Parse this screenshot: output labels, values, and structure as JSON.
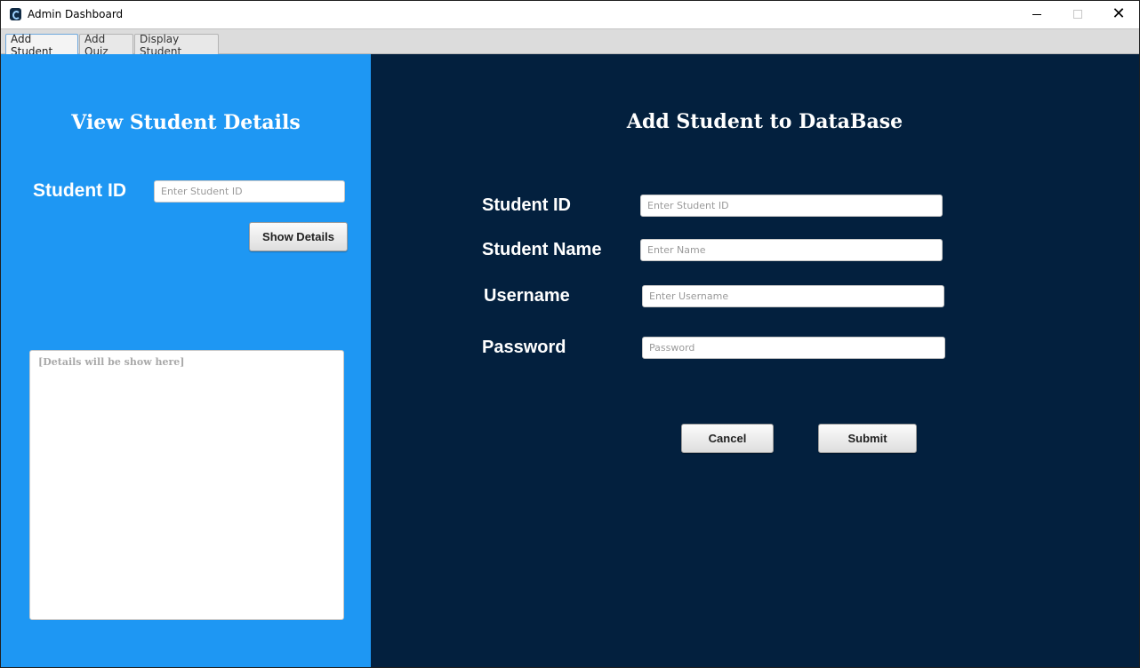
{
  "window": {
    "title": "Admin Dashboard",
    "minimize": "—",
    "maximize": "□",
    "close": "✕"
  },
  "tabs": [
    {
      "label": "Add Student",
      "active": true
    },
    {
      "label": "Add Quiz",
      "active": false
    },
    {
      "label": "Display Student",
      "active": false
    }
  ],
  "view_panel": {
    "title": "View Student Details",
    "student_id_label": "Student ID",
    "student_id_placeholder": "Enter Student ID",
    "show_details_button": "Show Details",
    "details_placeholder": "[Details will be show here]",
    "background_color": "#1e97f3"
  },
  "add_panel": {
    "title": "Add Student to DataBase",
    "fields": [
      {
        "label": "Student ID",
        "placeholder": "Enter Student ID"
      },
      {
        "label": "Student Name",
        "placeholder": "Enter Name"
      },
      {
        "label": "Username",
        "placeholder": "Enter Username"
      },
      {
        "label": "Password",
        "placeholder": "Password"
      }
    ],
    "cancel_button": "Cancel",
    "submit_button": "Submit",
    "background_color": "#03203e"
  }
}
